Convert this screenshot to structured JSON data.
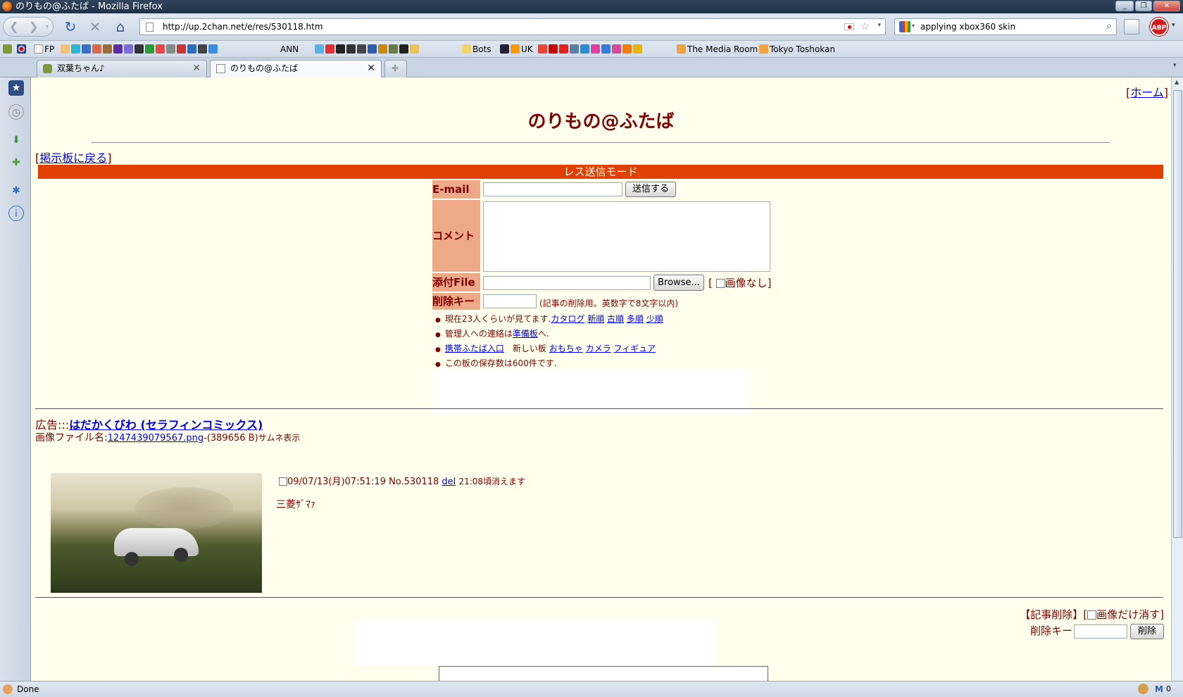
{
  "window": {
    "title": "のりもの@ふたば - Mozilla Firefox",
    "min": "_",
    "max": "❐",
    "close": "✕"
  },
  "nav": {
    "url": "http://up.2chan.net/e/res/530118.htm",
    "search_query": "applying xbox360 skin",
    "abp": "ABP"
  },
  "bookmarks": [
    {
      "label": "FP",
      "color": "#e8e8e8"
    },
    {
      "label": "ANN",
      "color": "#3a6ea5"
    },
    {
      "label": "UK",
      "color": "#f0f0f0"
    },
    {
      "label": "Bots",
      "color": "#f3d36b"
    },
    {
      "label": "The Media Room",
      "color": "#f4a23c"
    },
    {
      "label": "Tokyo Toshokan",
      "color": "#f4a23c"
    }
  ],
  "tabs": [
    {
      "label": "双葉ちゃん♪",
      "active": false
    },
    {
      "label": "のりもの@ふたば",
      "active": true
    }
  ],
  "page": {
    "home_link": "ホーム",
    "title": "のりもの@ふたば",
    "back_link": "掲示板に戻る",
    "mode_bar": "レス送信モード",
    "form": {
      "email_label": "E-mail",
      "submit_label": "送信する",
      "comment_label": "コメント",
      "file_label": "添付File",
      "browse_label": "Browse...",
      "no_image_label": "画像なし",
      "delkey_label": "削除キー",
      "delkey_note": "(記事の削除用。英数字で8文字以内)"
    },
    "info": {
      "line1_text": "現在23人くらいが見てます.",
      "line1_links": [
        "カタログ",
        "新順",
        "古順",
        "多順",
        "少順"
      ],
      "line2_pre": "管理人への連絡は",
      "line2_link": "準備板",
      "line2_post": "へ.",
      "line3_link1": "携帯ふたば入口",
      "line3_mid": "新しい板",
      "line3_links": [
        "おもちゃ",
        "カメラ",
        "フィギュア"
      ],
      "line4": "この板の保存数は600件です."
    },
    "ad_prefix": "広告:::",
    "ad_link": "はだかくびわ (セラフィンコミックス)",
    "post": {
      "file_prefix": "画像ファイル名:",
      "file_link": "1247439079567.png",
      "file_info": "-(389656 B)",
      "thumb_note": "サムネ表示",
      "date": "09/07/13(月)07:51:19",
      "number": "No.530118",
      "del_link": "del",
      "expire": "21:08頃消えます",
      "comment": "三菱ｻﾞﾏｧ"
    },
    "delete_form": {
      "title": "【記事削除】",
      "image_only": "画像だけ消す",
      "key_label": "削除キー",
      "button": "削除"
    }
  },
  "status": {
    "text": "Done",
    "mail_count": "0"
  },
  "colors": {
    "page_bg": "#ffffee",
    "text": "#800000",
    "mode_bar": "#e04000",
    "label_bg": "#eeaa88"
  }
}
